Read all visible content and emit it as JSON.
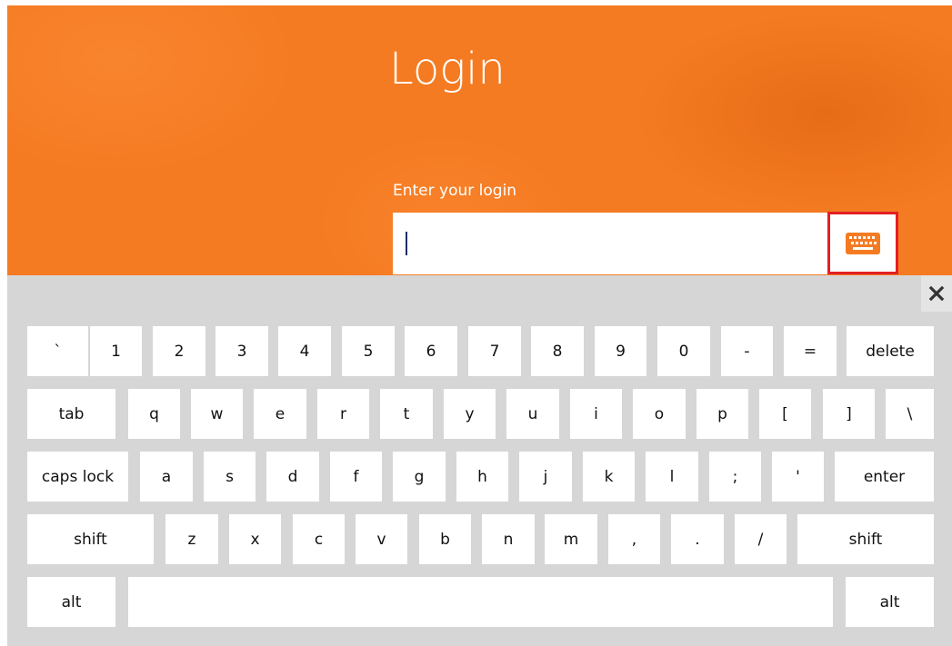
{
  "header": {
    "title": "Login",
    "login_label": "Enter your login",
    "login_value": ""
  },
  "colors": {
    "accent": "#f57b22",
    "keyboard_bg": "#d6d6d6",
    "highlight_border": "#e21f25"
  },
  "keyboard": {
    "close_icon": "close-icon",
    "toggle_icon": "keyboard-icon",
    "rows": [
      [
        "`",
        "1",
        "2",
        "3",
        "4",
        "5",
        "6",
        "7",
        "8",
        "9",
        "0",
        "-",
        "=",
        "delete"
      ],
      [
        "tab",
        "q",
        "w",
        "e",
        "r",
        "t",
        "y",
        "u",
        "i",
        "o",
        "p",
        "[",
        "]",
        "\\"
      ],
      [
        "caps lock",
        "a",
        "s",
        "d",
        "f",
        "g",
        "h",
        "j",
        "k",
        "l",
        ";",
        "'",
        "enter"
      ],
      [
        "shift",
        "z",
        "x",
        "c",
        "v",
        "b",
        "n",
        "m",
        ",",
        ".",
        "/",
        "shift"
      ],
      [
        "alt",
        "",
        "alt"
      ]
    ]
  }
}
